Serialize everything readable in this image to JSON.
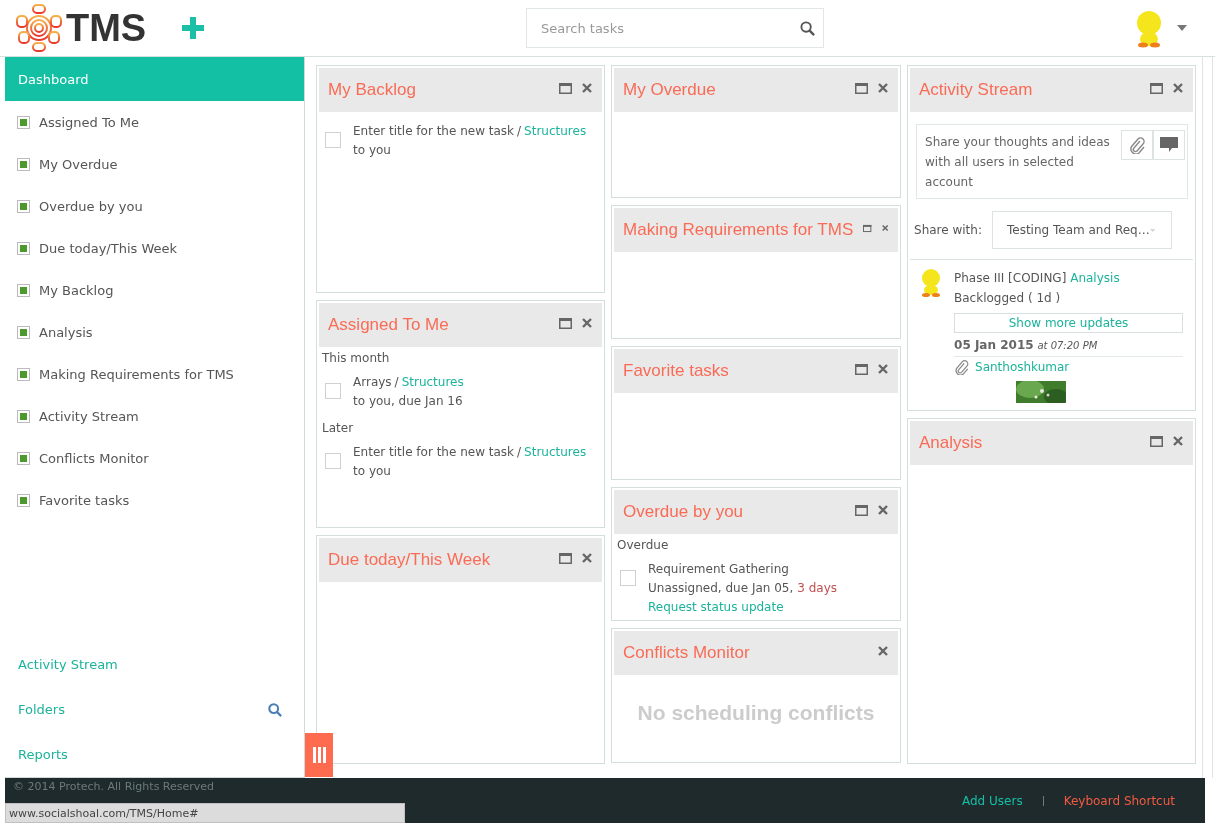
{
  "header": {
    "logo_text": "TMS",
    "search": {
      "placeholder": "Search tasks"
    }
  },
  "sidebar": {
    "items": [
      {
        "label": "Dashboard",
        "selected": true
      },
      {
        "label": "Assigned To Me",
        "selected": false
      },
      {
        "label": "My Overdue",
        "selected": false
      },
      {
        "label": "Overdue by you",
        "selected": false
      },
      {
        "label": "Due today/This Week",
        "selected": false
      },
      {
        "label": "My Backlog",
        "selected": false
      },
      {
        "label": "Analysis",
        "selected": false
      },
      {
        "label": "Making Requirements for TMS",
        "selected": false
      },
      {
        "label": "Activity Stream",
        "selected": false
      },
      {
        "label": "Conflicts Monitor",
        "selected": false
      },
      {
        "label": "Favorite tasks",
        "selected": false
      }
    ],
    "links": [
      {
        "label": "Activity Stream",
        "search": false
      },
      {
        "label": "Folders",
        "search": true
      },
      {
        "label": "Reports",
        "search": false
      }
    ]
  },
  "columns": [
    [
      {
        "title": "My Backlog",
        "maximize": true,
        "kind": "tasks",
        "groups": [
          {
            "tasks": [
              {
                "title": "Enter title for the new task",
                "separator": "/",
                "project": "Structures",
                "detail": "to you",
                "checked": false
              }
            ]
          }
        ]
      },
      {
        "title": "Assigned To Me",
        "maximize": true,
        "kind": "tasks",
        "groups": [
          {
            "label": "This month",
            "tasks": [
              {
                "title": "Arrays",
                "separator": "/",
                "project": "Structures",
                "detail": "to you, due Jan 16",
                "checked": false
              }
            ]
          },
          {
            "label": "Later",
            "tasks": [
              {
                "title": "Enter title for the new task",
                "separator": "/",
                "project": "Structures",
                "detail": "to you",
                "checked": false
              }
            ]
          }
        ]
      },
      {
        "title": "Due today/This Week",
        "maximize": true,
        "kind": "empty"
      }
    ],
    [
      {
        "title": "My Overdue",
        "maximize": true,
        "kind": "empty"
      },
      {
        "title": "Making Requirements for TMS",
        "maximize": true,
        "kind": "empty"
      },
      {
        "title": "Favorite tasks",
        "maximize": true,
        "kind": "empty"
      },
      {
        "title": "Overdue by you",
        "maximize": true,
        "kind": "tasks",
        "groups": [
          {
            "label": "Overdue",
            "tasks": [
              {
                "title": "Requirement Gathering",
                "detail": "Unassigned, due Jan 05,",
                "late": "3 days",
                "action": "Request status update",
                "checked": false
              }
            ]
          }
        ]
      },
      {
        "title": "Conflicts Monitor",
        "maximize": false,
        "kind": "message",
        "message": "No scheduling conflicts"
      }
    ],
    [
      {
        "title": "Activity Stream",
        "maximize": true,
        "kind": "activity",
        "composer": {
          "placeholder": "Share your thoughts and ideas with all users in selected account"
        },
        "share_label": "Share with:",
        "share_value": "Testing Team and Req…",
        "update": {
          "phase": "Phase III [CODING]",
          "link": "Analysis",
          "status": "Backlogged ( 1d )",
          "more": "Show more updates",
          "date": "05 Jan 2015",
          "time": "at 07:20 PM",
          "attachment": "Santhoshkumar"
        }
      },
      {
        "title": "Analysis",
        "maximize": true,
        "kind": "empty"
      }
    ]
  ],
  "footer": {
    "copyright": "© 2014 Protech. All Rights Reserved",
    "links": [
      {
        "label": "Add Users",
        "kind": "normal"
      },
      {
        "label": "Keyboard Shortcut",
        "kind": "active"
      }
    ],
    "status_url": "www.socialshoal.com/TMS/Home#"
  }
}
